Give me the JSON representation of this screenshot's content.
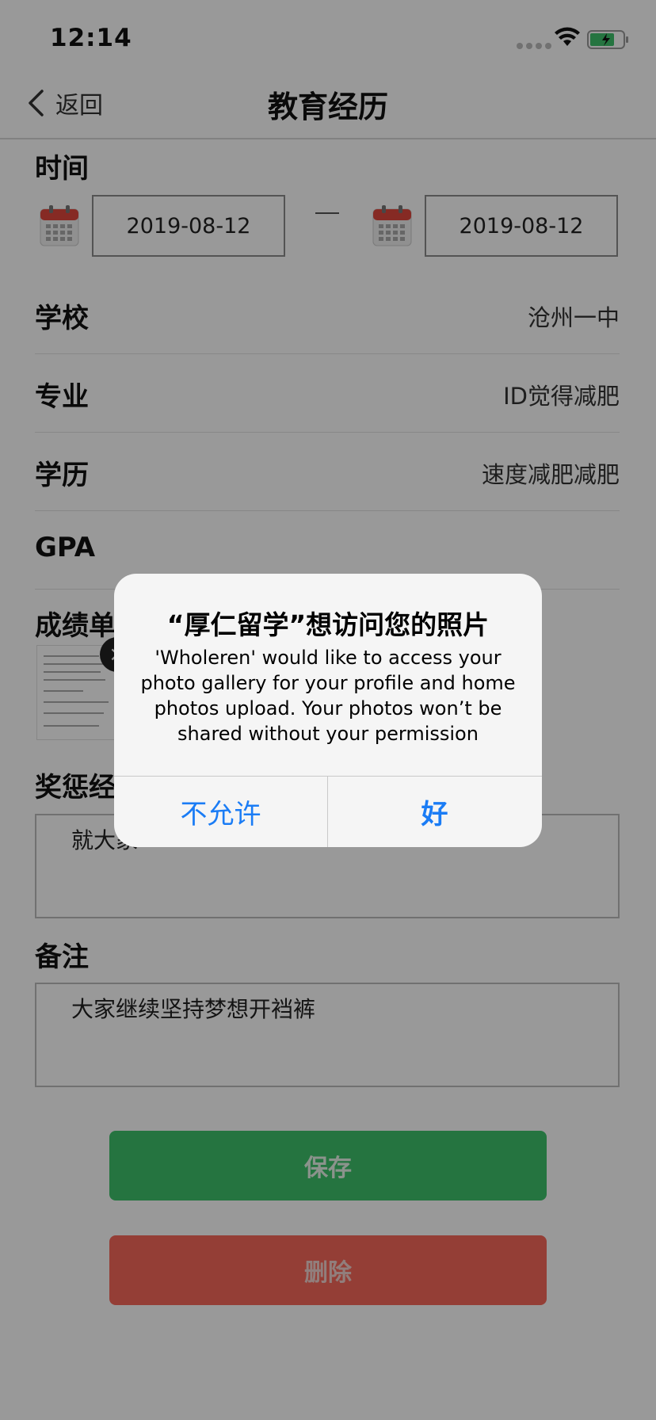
{
  "status": {
    "time": "12:14"
  },
  "nav": {
    "back_label": "返回",
    "title": "教育经历"
  },
  "time_section": {
    "label": "时间",
    "start_date": "2019-08-12",
    "end_date": "2019-08-12"
  },
  "fields": [
    {
      "label": "学校",
      "value": "沧州一中"
    },
    {
      "label": "专业",
      "value": "ID觉得减肥"
    },
    {
      "label": "学历",
      "value": "速度减肥减肥"
    },
    {
      "label": "GPA",
      "value": ""
    }
  ],
  "transcript": {
    "label": "成绩单"
  },
  "awards": {
    "label": "奖惩经历",
    "text": "就大家"
  },
  "notes": {
    "label": "备注",
    "text": "大家继续坚持梦想开裆裤"
  },
  "buttons": {
    "save": "保存",
    "delete": "删除"
  },
  "alert": {
    "title": "“厚仁留学”想访问您的照片",
    "message": "'Wholeren' would like to access your photo gallery for your profile and home photos upload. Your photos won’t be shared without your permission",
    "deny": "不允许",
    "allow": "好"
  },
  "colors": {
    "save": "#3fc16b",
    "delete": "#f7685a",
    "alert_button": "#1a7cf5"
  }
}
